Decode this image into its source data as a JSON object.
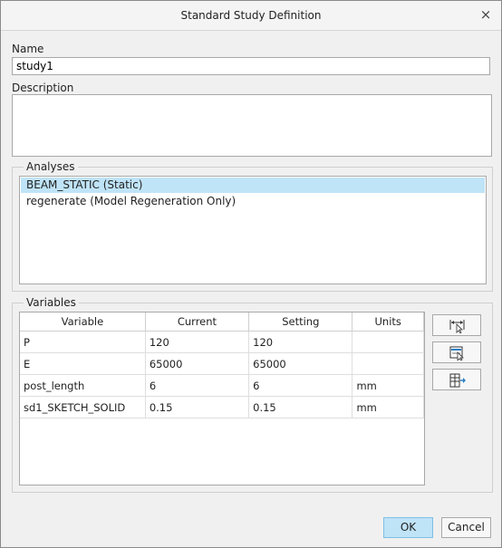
{
  "window": {
    "title": "Standard Study Definition",
    "close_label": "×"
  },
  "name": {
    "label": "Name",
    "value": "study1"
  },
  "description": {
    "label": "Description",
    "value": ""
  },
  "analyses": {
    "legend": "Analyses",
    "items": [
      {
        "label": "BEAM_STATIC (Static)",
        "selected": true
      },
      {
        "label": "regenerate (Model Regeneration Only)",
        "selected": false
      }
    ]
  },
  "variables": {
    "legend": "Variables",
    "columns": [
      "Variable",
      "Current",
      "Setting",
      "Units"
    ],
    "rows": [
      {
        "variable": "P",
        "current": "120",
        "setting": "120",
        "units": ""
      },
      {
        "variable": "E",
        "current": "65000",
        "setting": "65000",
        "units": ""
      },
      {
        "variable": "post_length",
        "current": "6",
        "setting": "6",
        "units": "mm"
      },
      {
        "variable": "sd1_SKETCH_SOLID",
        "current": "0.15",
        "setting": "0.15",
        "units": "mm"
      }
    ],
    "side_buttons": [
      "select-dimension-icon",
      "select-from-model-icon",
      "add-variable-icon"
    ]
  },
  "footer": {
    "ok_label": "OK",
    "cancel_label": "Cancel"
  },
  "colors": {
    "selection": "#bfe3f7",
    "ok_border": "#7fbfe6"
  }
}
